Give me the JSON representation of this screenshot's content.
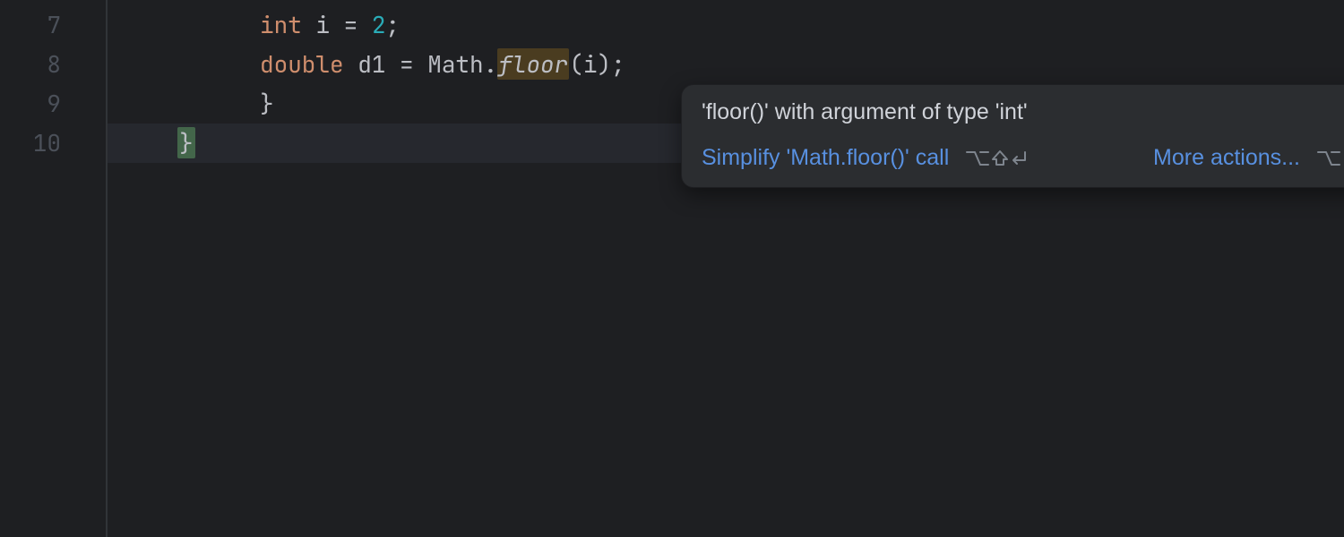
{
  "gutter": {
    "lines": [
      "7",
      "8",
      "9",
      "10"
    ]
  },
  "code": {
    "line7": {
      "kw": "int",
      "id": " i ",
      "eq": "=",
      "sp": " ",
      "num": "2",
      "semi": ";"
    },
    "line8": {
      "kw": "double",
      "id": " d1 ",
      "eq": "=",
      "sp": " ",
      "cls": "Math",
      "dot": ".",
      "fn": "floor",
      "lp": "(",
      "arg": "i",
      "rp": ")",
      "semi": ";"
    },
    "line9": {
      "brace": "}"
    },
    "line10": {
      "brace": "}"
    }
  },
  "popup": {
    "title": "'floor()' with argument of type 'int'",
    "action1": "Simplify 'Math.floor()' call",
    "shortcut1": "⌥⇧↵",
    "action2": "More actions...",
    "shortcut2": "⌥↵"
  }
}
